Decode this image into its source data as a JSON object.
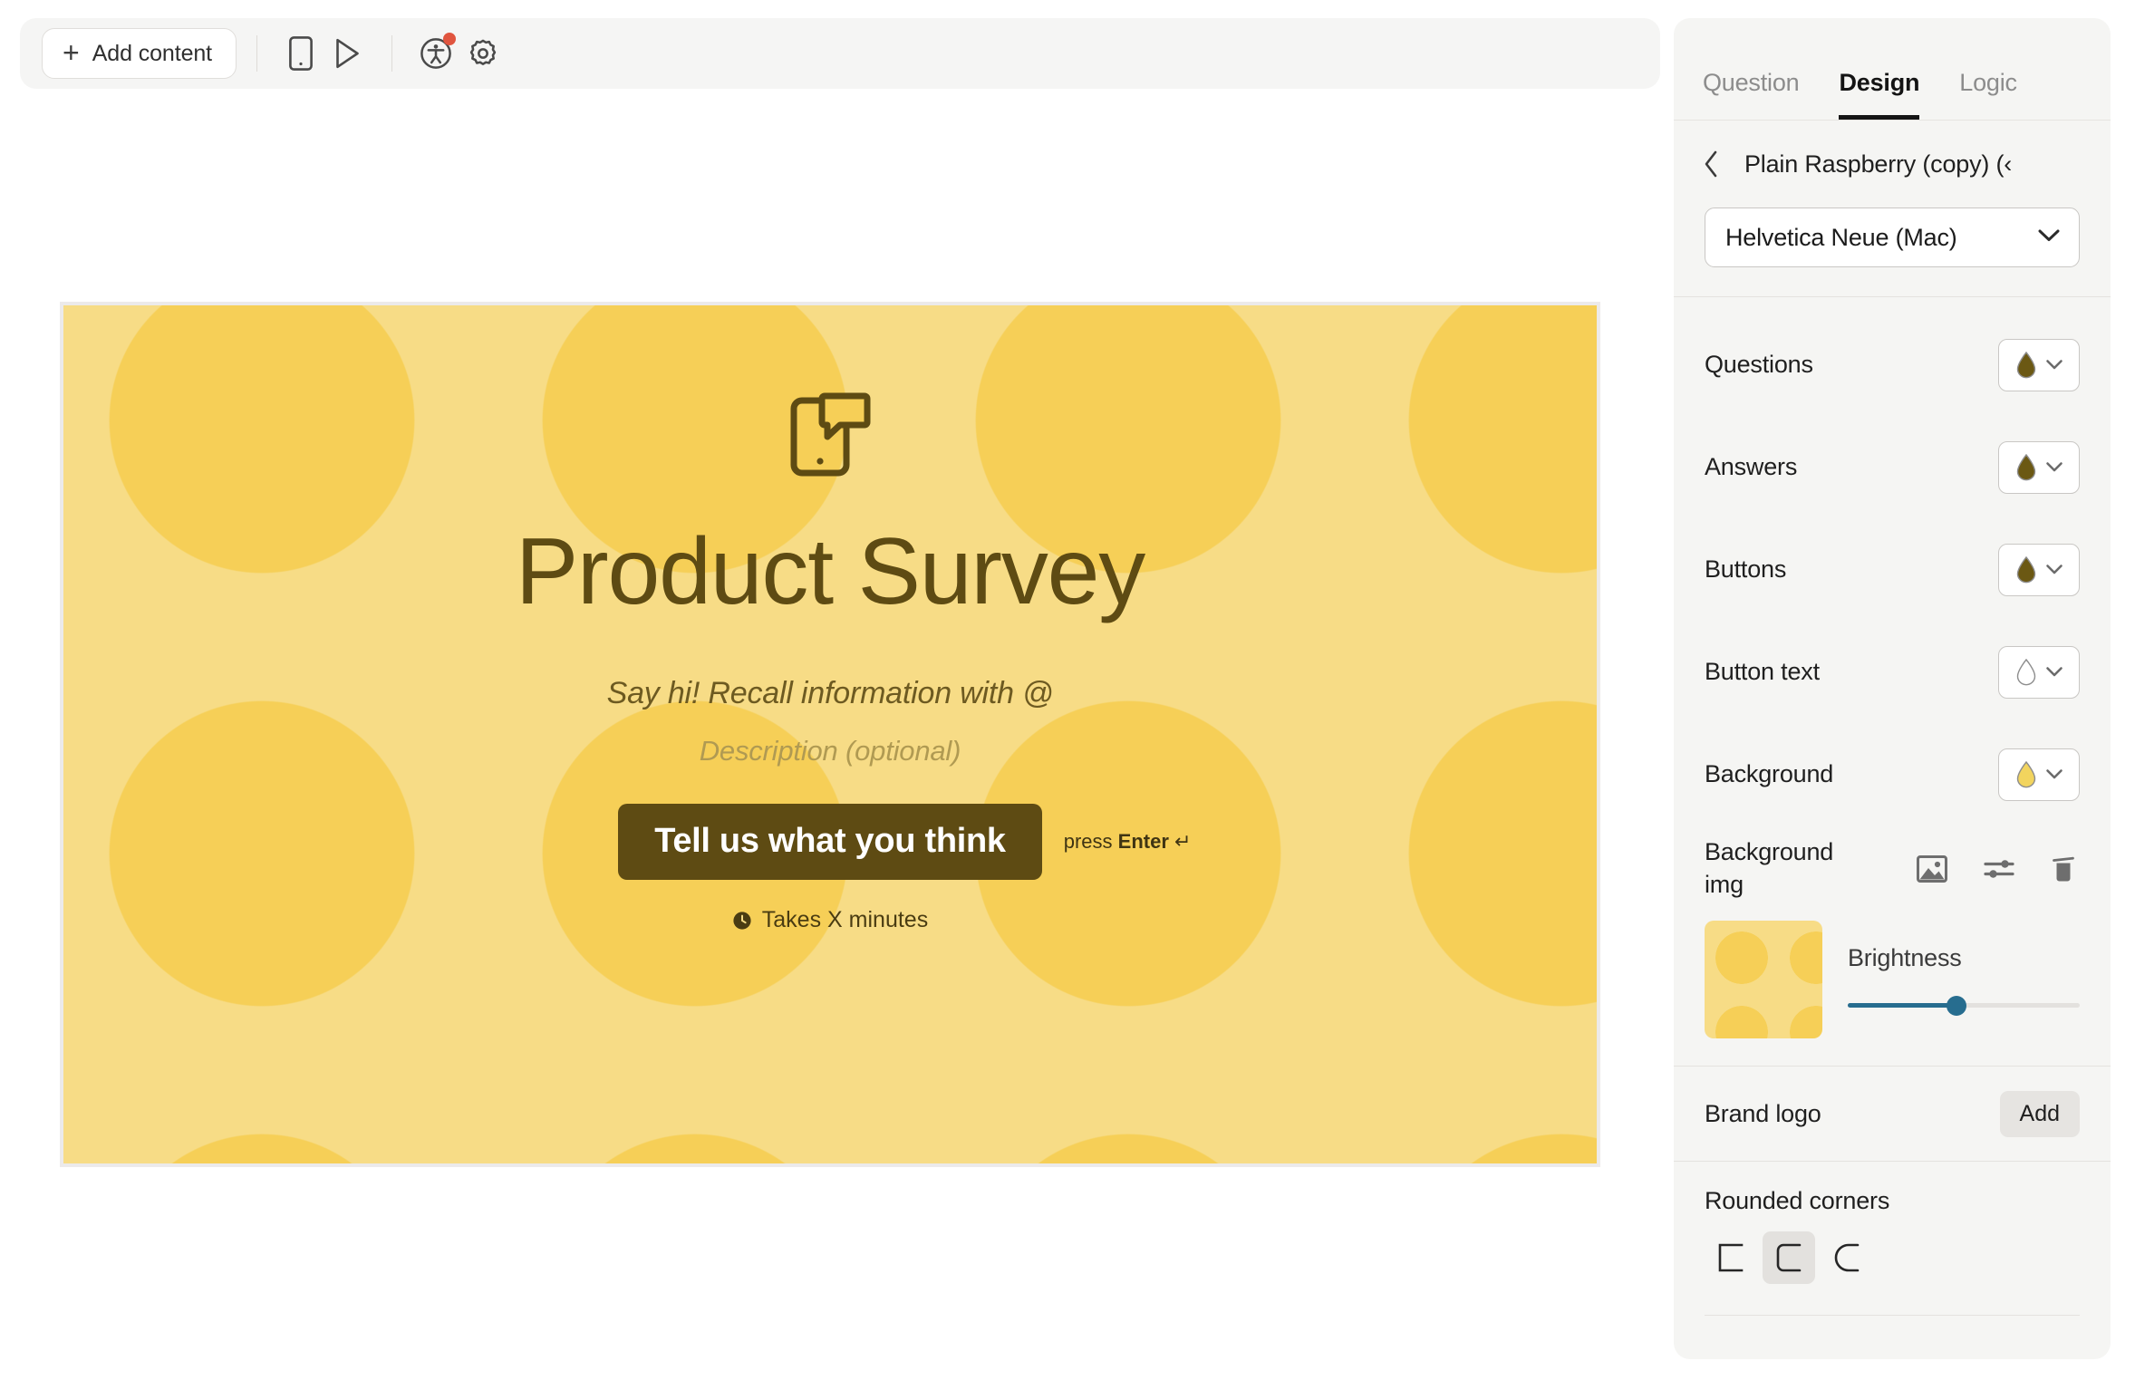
{
  "toolbar": {
    "add_content_label": "Add content",
    "plus_glyph": "+",
    "icons": [
      {
        "name": "mobile-preview-icon",
        "title": "Mobile preview"
      },
      {
        "name": "play-preview-icon",
        "title": "Preview"
      },
      {
        "name": "accessibility-icon",
        "title": "Accessibility",
        "has_notification_dot": true
      },
      {
        "name": "gear-icon",
        "title": "Settings"
      }
    ]
  },
  "canvas": {
    "icon_name": "phone-message-icon",
    "title": "Product Survey",
    "subtitle": "Say hi! Recall information with @",
    "description_placeholder": "Description (optional)",
    "cta_label": "Tell us what you think",
    "press_enter_prefix": "press ",
    "press_enter_key": "Enter",
    "press_enter_arrow": "↵",
    "takes_minutes": "Takes X minutes",
    "clock_icon": "clock-icon",
    "colors": {
      "background_light": "#f7dc86",
      "background_circles": "#f6cf57",
      "text_dark": "#5e4b13",
      "button_bg": "#5e4b13",
      "button_text": "#ffffff",
      "placeholder": "#b09a52"
    }
  },
  "panel": {
    "tabs": [
      {
        "label": "Question",
        "active": false
      },
      {
        "label": "Design",
        "active": true
      },
      {
        "label": "Logic",
        "active": false
      }
    ],
    "theme_name": "Plain Raspberry (copy) (‹",
    "back_chevron": "chevron-left-icon",
    "font": {
      "selected": "Helvetica Neue (Mac)",
      "chevron": "chevron-down-icon"
    },
    "color_rows": [
      {
        "label": "Questions",
        "swatch_color": "#6b5813",
        "swatch_filled": true
      },
      {
        "label": "Answers",
        "swatch_color": "#6b5813",
        "swatch_filled": true
      },
      {
        "label": "Buttons",
        "swatch_color": "#6b5813",
        "swatch_filled": true
      },
      {
        "label": "Button text",
        "swatch_color": "#ffffff",
        "swatch_filled": false
      },
      {
        "label": "Background",
        "swatch_color": "#f2d45e",
        "swatch_filled": true
      }
    ],
    "background_img": {
      "label": "Background img",
      "actions": [
        {
          "name": "image-icon",
          "title": "Choose image"
        },
        {
          "name": "adjust-sliders-icon",
          "title": "Adjust"
        },
        {
          "name": "trash-icon",
          "title": "Remove"
        }
      ],
      "brightness_label": "Brightness",
      "brightness_value": 47,
      "slider_color": "#276d8f"
    },
    "brand_logo": {
      "label": "Brand logo",
      "add_label": "Add"
    },
    "rounded_corners": {
      "label": "Rounded corners",
      "options": [
        {
          "name": "corner-square-icon",
          "selected": false
        },
        {
          "name": "corner-slightly-rounded-icon",
          "selected": true
        },
        {
          "name": "corner-fully-rounded-icon",
          "selected": false
        }
      ]
    }
  }
}
